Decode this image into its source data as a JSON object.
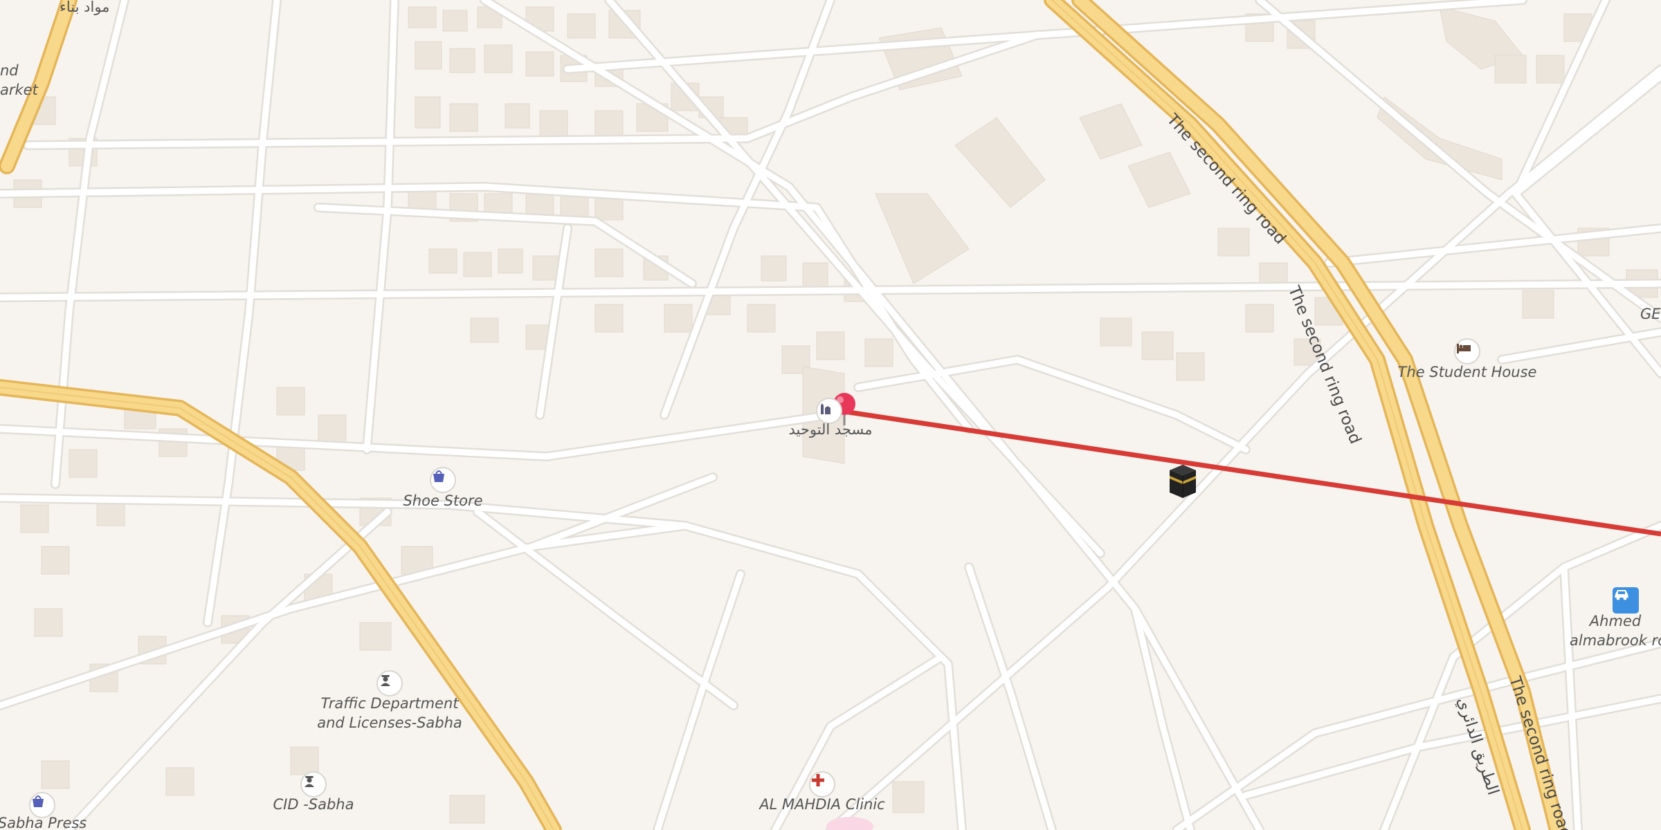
{
  "map": {
    "pin_label": "مسجد التوحيد",
    "places": {
      "shoe_store": "Shoe Store",
      "student_house": "The Student House",
      "traffic_dept_line1": "Traffic Department",
      "traffic_dept_line2": "and Licenses-Sabha",
      "cid": "CID -Sabha",
      "clinic": "AL MAHDIA Clinic",
      "press": "Sabha Press",
      "ahmed_line1": "Ahmed",
      "ahmed_line2": "almabrook ro",
      "ge": "GE",
      "market_line1": "nd",
      "market_line2": "arket",
      "materials": "مواد بناء"
    },
    "roads": {
      "ring_road": "The second ring road",
      "ring_road_arabic": "الطريق الدائري"
    },
    "colors": {
      "background": "#f7f4ef",
      "street": "#ffffff",
      "street_casing": "#e2ded8",
      "major_road": "#f8d88a",
      "major_road_casing": "#e5b65a",
      "building": "#ebe5dc",
      "direction_line": "#d83a35",
      "pin": "#e8385a",
      "poi_icon": "#5a5a7a"
    },
    "icons": {
      "pin": "map-pin-icon",
      "mosque": "mosque-icon",
      "kaaba": "kaaba-icon",
      "shop": "shopping-bag-icon",
      "hotel": "bed-icon",
      "police": "police-officer-icon",
      "hospital": "red-cross-icon",
      "car": "car-icon"
    }
  }
}
